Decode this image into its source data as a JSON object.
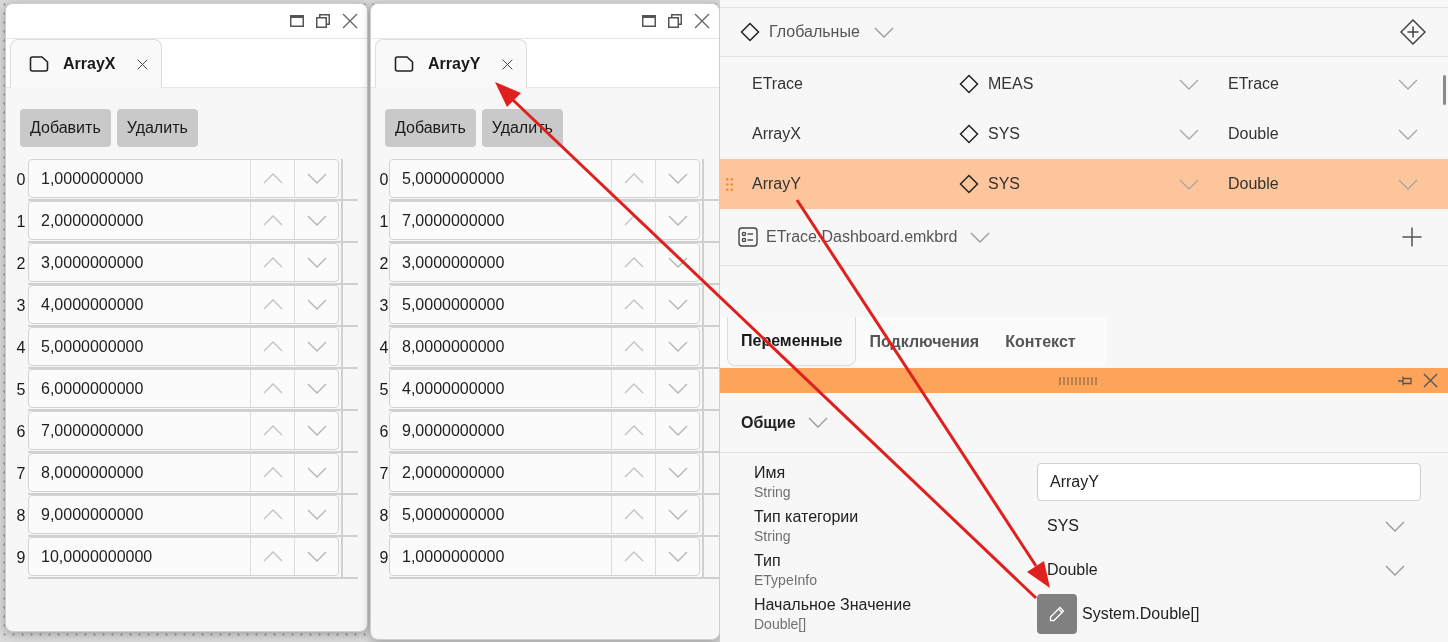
{
  "array_windows": [
    {
      "tab": {
        "label": "ArrayX",
        "selected": true
      },
      "buttons": [
        "Добавить",
        "Удалить"
      ],
      "items": [
        {
          "index": "0",
          "value": "1,0000000000"
        },
        {
          "index": "1",
          "value": "2,0000000000"
        },
        {
          "index": "2",
          "value": "3,0000000000"
        },
        {
          "index": "3",
          "value": "4,0000000000"
        },
        {
          "index": "4",
          "value": "5,0000000000"
        },
        {
          "index": "5",
          "value": "6,0000000000"
        },
        {
          "index": "6",
          "value": "7,0000000000"
        },
        {
          "index": "7",
          "value": "8,0000000000"
        },
        {
          "index": "8",
          "value": "9,0000000000"
        },
        {
          "index": "9",
          "value": "10,0000000000"
        }
      ]
    },
    {
      "tab": {
        "label": "ArrayY",
        "selected": true
      },
      "buttons": [
        "Добавить",
        "Удалить"
      ],
      "items": [
        {
          "index": "0",
          "value": "5,0000000000"
        },
        {
          "index": "1",
          "value": "7,0000000000"
        },
        {
          "index": "2",
          "value": "3,0000000000"
        },
        {
          "index": "3",
          "value": "5,0000000000"
        },
        {
          "index": "4",
          "value": "8,0000000000"
        },
        {
          "index": "5",
          "value": "4,0000000000"
        },
        {
          "index": "6",
          "value": "9,0000000000"
        },
        {
          "index": "7",
          "value": "2,0000000000"
        },
        {
          "index": "8",
          "value": "5,0000000000"
        },
        {
          "index": "9",
          "value": "1,0000000000"
        }
      ]
    }
  ],
  "globals": {
    "title": "Глобальные",
    "variables": [
      {
        "name": "ETrace",
        "category": "MEAS",
        "type": "ETrace",
        "selected": false
      },
      {
        "name": "ArrayX",
        "category": "SYS",
        "type": "Double",
        "selected": false
      },
      {
        "name": "ArrayY",
        "category": "SYS",
        "type": "Double",
        "selected": true
      }
    ]
  },
  "dashboard": {
    "title": "ETrace.Dashboard.emkbrd"
  },
  "tabs": [
    {
      "label": "Переменные",
      "selected": true
    },
    {
      "label": "Подключения",
      "selected": false
    },
    {
      "label": "Контекст",
      "selected": false
    }
  ],
  "properties": {
    "section": "Общие",
    "fields": [
      {
        "kind": "text",
        "label": "Имя",
        "type": "String",
        "value": "ArrayY"
      },
      {
        "kind": "dropdown",
        "label": "Тип категории",
        "type": "String",
        "value": "SYS"
      },
      {
        "kind": "dropdown",
        "label": "Тип",
        "type": "ETypeInfo",
        "value": "Double"
      },
      {
        "kind": "editor",
        "label": "Начальное Значение",
        "type": "Double[]",
        "value": "System.Double[]"
      }
    ]
  }
}
